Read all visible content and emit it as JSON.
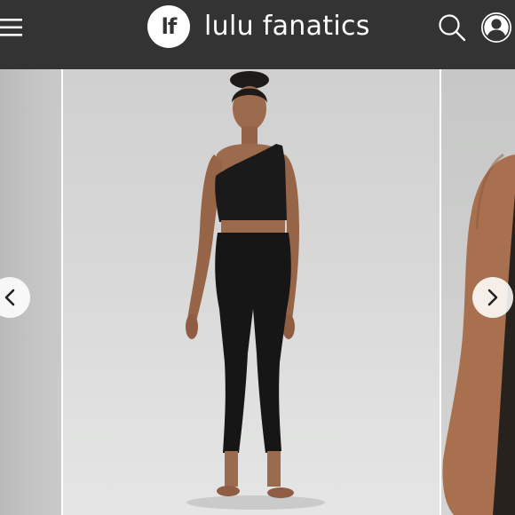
{
  "header": {
    "logo_text": "lf",
    "brand_name": "lulu fanatics",
    "background": "#333333"
  },
  "icons": {
    "menu": "hamburger-menu-icon",
    "search": "search-icon",
    "account": "user-account-icon",
    "prev": "chevron-left-icon",
    "next": "chevron-right-icon"
  },
  "carousel": {
    "slides": [
      {
        "name": "previous-product-image"
      },
      {
        "name": "current-product-image"
      },
      {
        "name": "next-product-image"
      }
    ]
  }
}
